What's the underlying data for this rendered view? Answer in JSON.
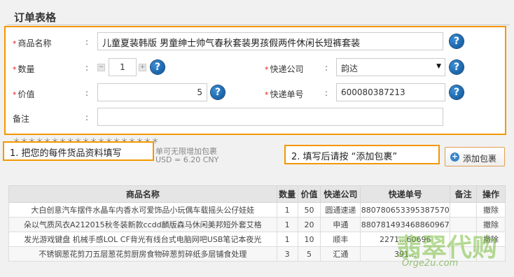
{
  "section_title": "订单表格",
  "form": {
    "product_name": {
      "label": "商品名称",
      "colon": ":",
      "value": "儿童夏装韩版 男童绅士帅气春秋套装男孩假两件休闲长短裤套装",
      "help": "?"
    },
    "quantity": {
      "label": "数量",
      "colon": ":",
      "value": "1",
      "minus": "−",
      "plus": "+",
      "help": "?"
    },
    "courier_company": {
      "label": "快递公司",
      "colon": ":",
      "value": "韵达",
      "help": "?"
    },
    "price": {
      "label": "价值",
      "colon": ":",
      "value": "5",
      "help": "?"
    },
    "tracking_number": {
      "label": "快递单号",
      "colon": ":",
      "value": "600080387213",
      "help": "?"
    },
    "remark": {
      "label": "备注",
      "colon": ":",
      "value": ""
    },
    "required_mark": "*"
  },
  "behind_text": {
    "line2": "单可无限增加包裹",
    "line3": "USD = 6.20 CNY"
  },
  "callouts": {
    "step1": "1.  把您的每件货品资料填写",
    "step2": "2.  填写后请按 “添加包裹”"
  },
  "add_button": {
    "label": "添加包裹",
    "icon": "plus-circle-icon"
  },
  "table": {
    "headers": [
      "商品名称",
      "数量",
      "价值",
      "快递公司",
      "快递单号",
      "备注",
      "操作"
    ],
    "rows": [
      [
        "大白创意汽车摆件水晶车内香水可爱饰品小玩偶车载摇头公仔娃娃",
        "1",
        "50",
        "圆通速递",
        "880780653395387570",
        "",
        "撤除"
      ],
      [
        "朵以气质风衣A212015秋冬装新款ccdd麟版森马休闲美邦短外套艾格",
        "1",
        "20",
        "申通",
        "880781493468860967",
        "",
        "撤除"
      ],
      [
        "发光游戏键盘 机械手感LOL CF背光有线台式电脑网吧USB笔记本夜光",
        "1",
        "10",
        "顺丰",
        "2271...60696",
        "",
        "撤除"
      ],
      [
        "不锈钢葱花剪刀五层葱花剪厨房食物碎葱剪碎纸多层铺食处理",
        "3",
        "5",
        "汇通",
        "391...",
        "",
        ""
      ]
    ]
  },
  "watermark": {
    "text": "翡翠代购",
    "url": "Orge2u.com"
  },
  "colors": {
    "accent": "#f39800",
    "help_blue": "#0b4f93",
    "required": "#e02020"
  }
}
